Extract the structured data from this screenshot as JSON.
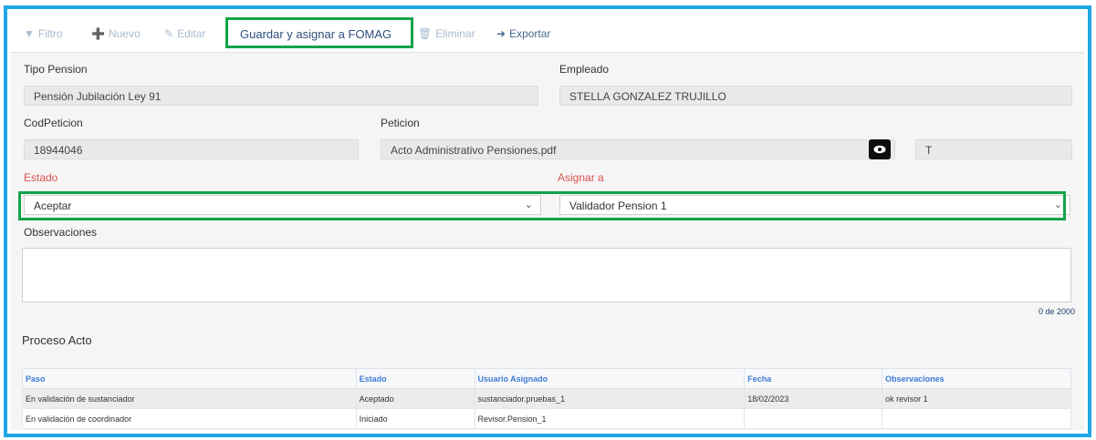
{
  "toolbar": {
    "filtro": "Filtro",
    "nuevo": "Nuevo",
    "editar": "Editar",
    "guardar": "Guardar y asignar a FOMAG",
    "eliminar": "Eliminar",
    "exportar": "Exportar"
  },
  "form": {
    "tipo_pension_label": "Tipo Pension",
    "tipo_pension_value": "Pensión Jubilación Ley 91",
    "empleado_label": "Empleado",
    "empleado_value": "STELLA GONZALEZ TRUJILLO",
    "codpeticion_label": "CodPeticion",
    "codpeticion_value": "18944046",
    "peticion_label": "Peticion",
    "peticion_value": "Acto Administrativo Pensiones.pdf",
    "peticion_extra_value": "T",
    "estado_label": "Estado",
    "estado_value": "Aceptar",
    "asignar_label": "Asignar a",
    "asignar_value": "Validador Pension 1",
    "observaciones_label": "Observaciones",
    "observaciones_value": "",
    "counter": "0 de 2000"
  },
  "proceso": {
    "title": "Proceso Acto",
    "headers": [
      "Paso",
      "Estado",
      "Usuario Asignado",
      "Fecha",
      "Observaciones"
    ],
    "rows": [
      [
        "En validación de sustanciador",
        "Aceptado",
        "sustanciador.pruebas_1",
        "18/02/2023",
        "ok revisor 1"
      ],
      [
        "En validación de coordinador",
        "Iniciado",
        "Revisor.Pension_1",
        "",
        ""
      ]
    ]
  },
  "icons": {
    "filter": "filter-icon",
    "new": "plus-circle-icon",
    "edit": "pencil-square-icon",
    "delete": "trash-icon",
    "export": "export-icon",
    "view": "eye-icon",
    "dropdown": "chevron-down-icon"
  },
  "colors": {
    "frame_border": "#1ea7e4",
    "highlight": "#12a34a",
    "required_label": "#d9534f",
    "table_header": "#3d7ad6"
  }
}
